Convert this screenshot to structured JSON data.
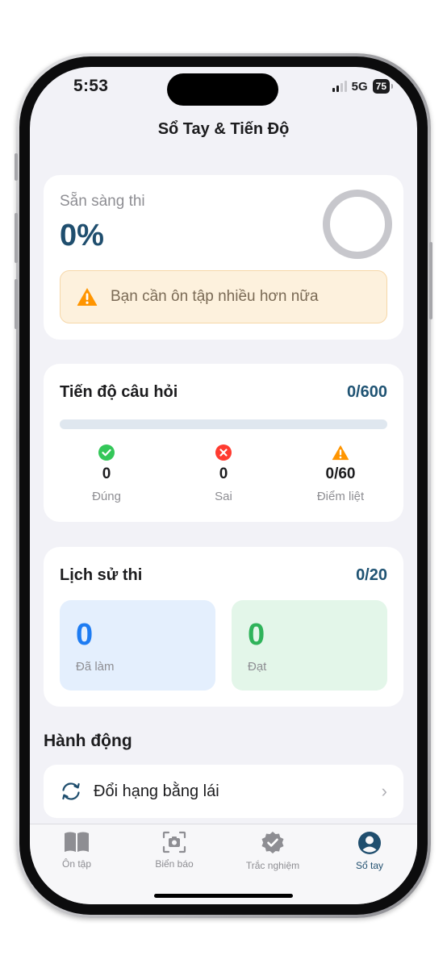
{
  "status_bar": {
    "time": "5:53",
    "network": "5G",
    "battery": "75"
  },
  "header": {
    "title": "Sổ Tay & Tiến Độ"
  },
  "readiness": {
    "label": "Sẵn sàng thi",
    "value": "0%",
    "progress_fraction": 0,
    "warning": "Bạn cần ôn tập nhiều hơn nữa"
  },
  "question_progress": {
    "title": "Tiến độ câu hỏi",
    "count": "0/600",
    "progress_fraction": 0,
    "stats": [
      {
        "icon": "check-circle-icon",
        "value": "0",
        "label": "Đúng",
        "color": "#34c759"
      },
      {
        "icon": "x-circle-icon",
        "value": "0",
        "label": "Sai",
        "color": "#ff3b30"
      },
      {
        "icon": "warning-triangle-icon",
        "value": "0/60",
        "label": "Điểm liệt",
        "color": "#ff9500"
      }
    ]
  },
  "exam_history": {
    "title": "Lịch sử thi",
    "count": "0/20",
    "done": {
      "value": "0",
      "label": "Đã làm",
      "color": "#1e7cf2",
      "background": "#e4effd"
    },
    "passed": {
      "value": "0",
      "label": "Đạt",
      "color": "#2fb35a",
      "background": "#e3f6e9"
    }
  },
  "actions": {
    "title": "Hành động",
    "items": [
      {
        "icon": "refresh-icon",
        "label": "Đổi hạng bằng lái"
      }
    ]
  },
  "tabs": [
    {
      "icon": "book-icon",
      "label": "Ôn tập",
      "active": false
    },
    {
      "icon": "camera-frame-icon",
      "label": "Biển báo",
      "active": false
    },
    {
      "icon": "badge-check-icon",
      "label": "Trắc nghiệm",
      "active": false
    },
    {
      "icon": "profile-icon",
      "label": "Sổ tay",
      "active": true
    }
  ],
  "colors": {
    "accent": "#1f4e6e",
    "warning": "#ff9500",
    "background": "#f2f2f7"
  }
}
